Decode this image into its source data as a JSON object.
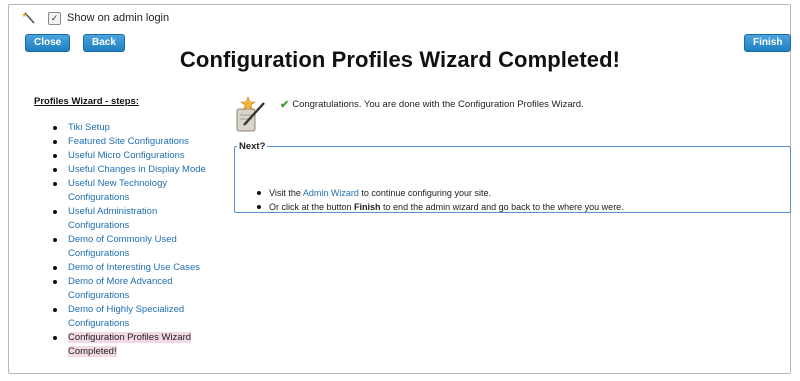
{
  "topbar": {
    "show_on_login_label": "Show on admin login",
    "show_on_login_checked": true
  },
  "buttons": {
    "close": "Close",
    "back": "Back",
    "finish": "Finish"
  },
  "page_title": "Configuration Profiles Wizard Completed!",
  "sidebar": {
    "title": "Profiles Wizard - steps:",
    "steps": [
      "Tiki Setup",
      "Featured Site Configurations",
      "Useful Micro Configurations",
      "Useful Changes in Display Mode",
      "Useful New Technology Configurations",
      "Useful Administration Configurations",
      "Demo of Commonly Used Configurations",
      "Demo of Interesting Use Cases",
      "Demo of More Advanced Configurations",
      "Demo of Highly Specialized Configurations",
      "Configuration Profiles Wizard Completed!"
    ]
  },
  "main": {
    "congrats": "Congratulations. You are done with the Configuration Profiles Wizard.",
    "next_legend": "Next?",
    "item1_pre": "Visit the ",
    "item1_link": "Admin Wizard",
    "item1_post": " to continue configuring your site.",
    "item2_pre": "Or click at the button ",
    "item2_bold": "Finish",
    "item2_post": " to end the admin wizard and go back to the where you were."
  },
  "colors": {
    "accent": "#2a8bd0",
    "link": "#1f6fb2",
    "highlight": "#f3d9e5",
    "check": "#3aa12e"
  },
  "icons": {
    "wand": "magic-wand-icon",
    "wizard": "wizard-hat-icon",
    "check": "checkmark-icon"
  }
}
